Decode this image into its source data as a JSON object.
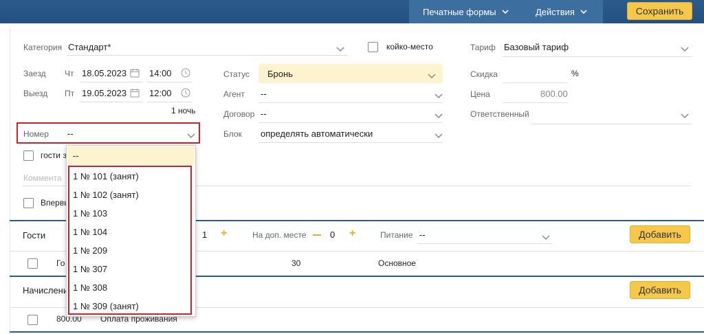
{
  "topbar": {
    "print_forms_label": "Печатные формы",
    "actions_label": "Действия",
    "save_label": "Сохранить"
  },
  "form": {
    "category_label": "Категория",
    "category_value": "Стандарт*",
    "bed_place_label": "койко-место",
    "tariff_label": "Тариф",
    "tariff_value": "Базовый тариф",
    "checkin_label": "Заезд",
    "checkin_day": "Чт",
    "checkin_date": "18.05.2023",
    "checkin_time": "14:00",
    "checkout_label": "Выезд",
    "checkout_day": "Пт",
    "checkout_date": "19.05.2023",
    "checkout_time": "12:00",
    "nights": "1 ночь",
    "status_label": "Статус",
    "status_value": "Бронь",
    "agent_label": "Агент",
    "agent_value": "--",
    "contract_label": "Договор",
    "contract_value": "--",
    "block_label": "Блок",
    "block_value": "определять автоматически",
    "discount_label": "Скидка",
    "discount_unit": "%",
    "price_label": "Цена",
    "price_value": "800.00",
    "responsible_label": "Ответственный",
    "room_label": "Номер",
    "room_value": "--",
    "guests_checkbox_label": "гости з",
    "comment_placeholder": "Коммента",
    "first_time_label": "Впервы"
  },
  "guests_section": {
    "title": "Гости",
    "count": "1",
    "extra_place_label": "На доп. месте",
    "extra_count": "0",
    "meal_label": "Питание",
    "meal_value": "--",
    "add_label": "Добавить",
    "row_name": "Го",
    "row_age": "30",
    "row_type": "Основное"
  },
  "charges_section": {
    "title": "Начислени",
    "add_label": "Добавить",
    "row_amount": "800.00",
    "row_name": "Оплата проживания"
  },
  "room_dropdown": {
    "selected": "--",
    "options": [
      "1 № 101 (занят)",
      "1 № 102 (занят)",
      "1 № 103",
      "1 № 104",
      "1 № 209",
      "1 № 307",
      "1 № 308",
      "1 № 309 (занят)"
    ]
  },
  "colors": {
    "topbar": "#2b5b8d",
    "menu_group": "#3d6ea0",
    "accent_button": "#f5c84c",
    "status_field": "#fdf3cf",
    "highlight": "#d0202a"
  }
}
